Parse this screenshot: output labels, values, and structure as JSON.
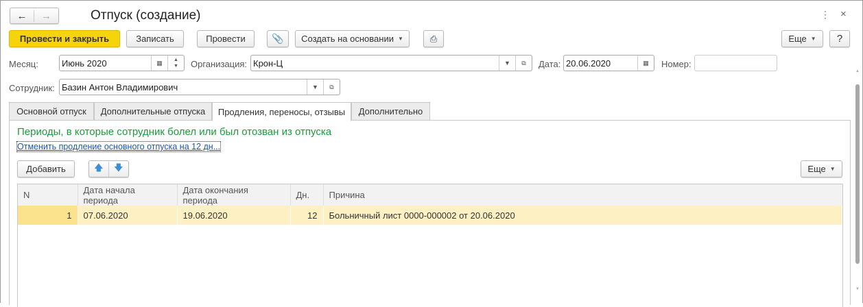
{
  "window": {
    "title": "Отпуск (создание)"
  },
  "toolbar": {
    "post_close": "Провести и закрыть",
    "save": "Записать",
    "post": "Провести",
    "create_based": "Создать на основании",
    "more": "Еще",
    "help": "?"
  },
  "header": {
    "month_label": "Месяц:",
    "month_value": "Июнь 2020",
    "org_label": "Организация:",
    "org_value": "Крон-Ц",
    "date_label": "Дата:",
    "date_value": "20.06.2020",
    "number_label": "Номер:",
    "number_value": "",
    "employee_label": "Сотрудник:",
    "employee_value": "Базин Антон Владимирович"
  },
  "tabs": [
    "Основной отпуск",
    "Дополнительные отпуска",
    "Продления, переносы, отзывы",
    "Дополнительно"
  ],
  "panel": {
    "heading": "Периоды, в которые сотрудник болел или был отозван из отпуска",
    "link": "Отменить продление основного отпуска на 12 дн...",
    "add": "Добавить",
    "more": "Еще"
  },
  "table": {
    "columns": [
      "N",
      "Дата начала периода",
      "Дата окончания периода",
      "Дн.",
      "Причина"
    ],
    "rows": [
      [
        "1",
        "07.06.2020",
        "19.06.2020",
        "12",
        "Больничный лист 0000-000002 от 20.06.2020"
      ]
    ]
  },
  "colors": {
    "primary": "#f5d40b",
    "heading": "#1a9c3c",
    "link": "#1a57b8",
    "row": "#fdf1c3"
  }
}
